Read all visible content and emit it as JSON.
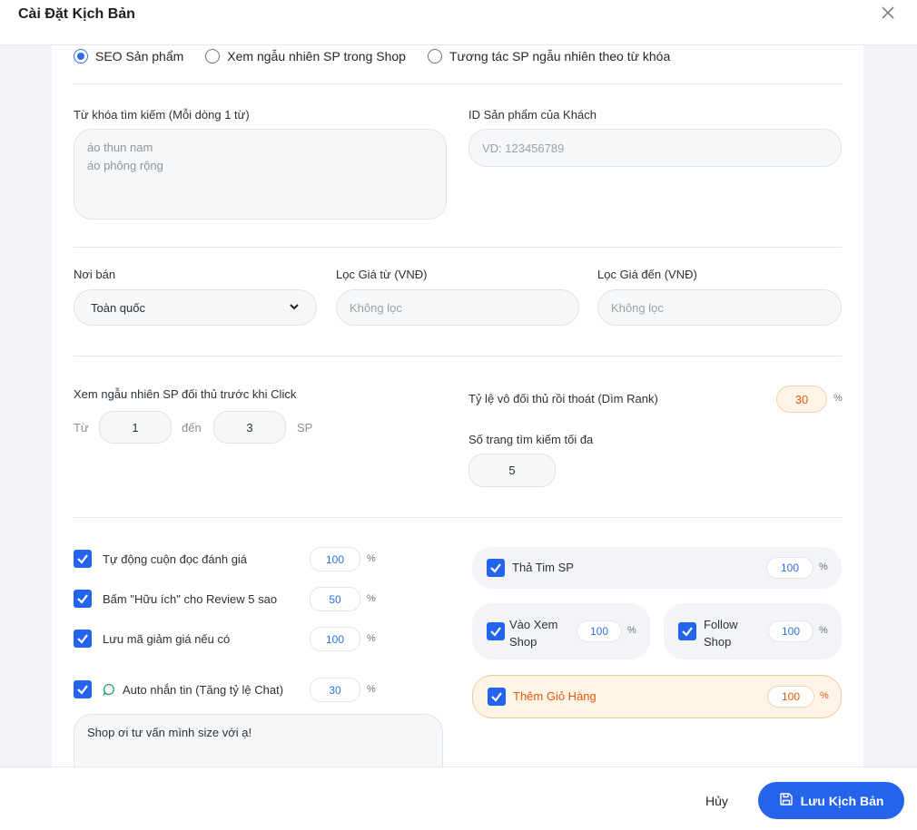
{
  "dialog": {
    "title": "Cài Đặt Kịch Bản"
  },
  "mode": {
    "options": [
      {
        "label": "SEO Sản phẩm",
        "selected": true
      },
      {
        "label": "Xem ngẫu nhiên SP trong Shop",
        "selected": false
      },
      {
        "label": "Tương tác SP ngẫu nhiên theo từ khóa",
        "selected": false
      }
    ]
  },
  "keywords": {
    "label": "Từ khóa tìm kiếm (Mỗi dòng 1 từ)",
    "placeholder_lines": [
      "áo thun nam",
      "áo phông rộng"
    ]
  },
  "product_id": {
    "label": "ID Sản phẩm của Khách",
    "placeholder": "VD: 123456789"
  },
  "filters": {
    "location_label": "Nơi bán",
    "location_value": "Toàn quốc",
    "price_from_label": "Lọc Giá từ (VNĐ)",
    "price_from_placeholder": "Không lọc",
    "price_to_label": "Lọc Giá đến (VNĐ)",
    "price_to_placeholder": "Không lọc"
  },
  "competitor": {
    "label": "Xem ngẫu nhiên SP đối thủ trước khi Click",
    "from_label": "Từ",
    "from_value": "1",
    "to_label": "đến",
    "to_value": "3",
    "unit": "SP"
  },
  "dim_rank": {
    "label": "Tỷ lệ vô đối thủ rồi thoát (Dìm Rank)",
    "value": "30",
    "unit": "%"
  },
  "max_pages": {
    "label": "Số trang tìm kiếm tối đa",
    "value": "5"
  },
  "actions_left": [
    {
      "label": "Tự động cuộn đọc đánh giá",
      "value": "100",
      "unit": "%",
      "checked": true
    },
    {
      "label": "Bấm \"Hữu ích\" cho Review 5 sao",
      "value": "50",
      "unit": "%",
      "checked": true
    },
    {
      "label": "Lưu mã giảm giá nếu có",
      "value": "100",
      "unit": "%",
      "checked": true
    }
  ],
  "auto_chat": {
    "label": "Auto nhắn tin (Tăng tỷ lệ Chat)",
    "value": "30",
    "unit": "%",
    "checked": true,
    "message": "Shop ơi tư vấn mình size với ạ!"
  },
  "actions_right": {
    "like": {
      "label": "Thả Tim SP",
      "value": "100",
      "unit": "%",
      "checked": true
    },
    "view_shop": {
      "label_line1": "Vào Xem",
      "label_line2": "Shop",
      "value": "100",
      "unit": "%",
      "checked": true
    },
    "follow_shop": {
      "label_line1": "Follow",
      "label_line2": "Shop",
      "value": "100",
      "unit": "%",
      "checked": true
    },
    "add_cart": {
      "label": "Thêm Giỏ Hàng",
      "value": "100",
      "unit": "%",
      "checked": true
    }
  },
  "footer": {
    "cancel_label": "Hủy",
    "save_label": "Lưu Kịch Bản"
  },
  "colors": {
    "accent": "#2563eb",
    "orange": "#e8590c",
    "orange_bg": "#fff4e8"
  }
}
